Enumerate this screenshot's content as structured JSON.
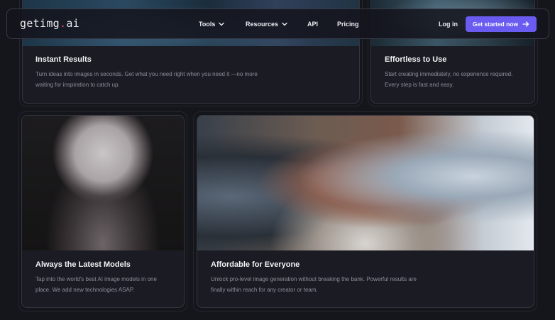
{
  "header": {
    "logo_main": "getimg",
    "logo_dot": ".",
    "logo_tld": "ai",
    "nav": {
      "tools": "Tools",
      "resources": "Resources",
      "api": "API",
      "pricing": "Pricing"
    },
    "login": "Log in",
    "cta": "Get started now"
  },
  "cards": {
    "instant": {
      "title": "Instant Results",
      "desc": "Turn ideas into images in seconds. Get what you need right when you need it —no more waiting for inspiration to catch up."
    },
    "effortless": {
      "title": "Effortless to Use",
      "desc": "Start creating immediately, no experience required. Every step is fast and easy."
    },
    "latest": {
      "title": "Always the Latest Models",
      "desc": "Tap into the world's best AI image models in one place. We add new technologies ASAP."
    },
    "affordable": {
      "title": "Affordable for Everyone",
      "desc": "Unlock pro-level image generation without breaking the bank. Powerful results are finally within reach for any creator or team."
    }
  },
  "colors": {
    "background": "#15151c",
    "accent": "#6a5cf0",
    "logo_dot": "#e2487a"
  }
}
